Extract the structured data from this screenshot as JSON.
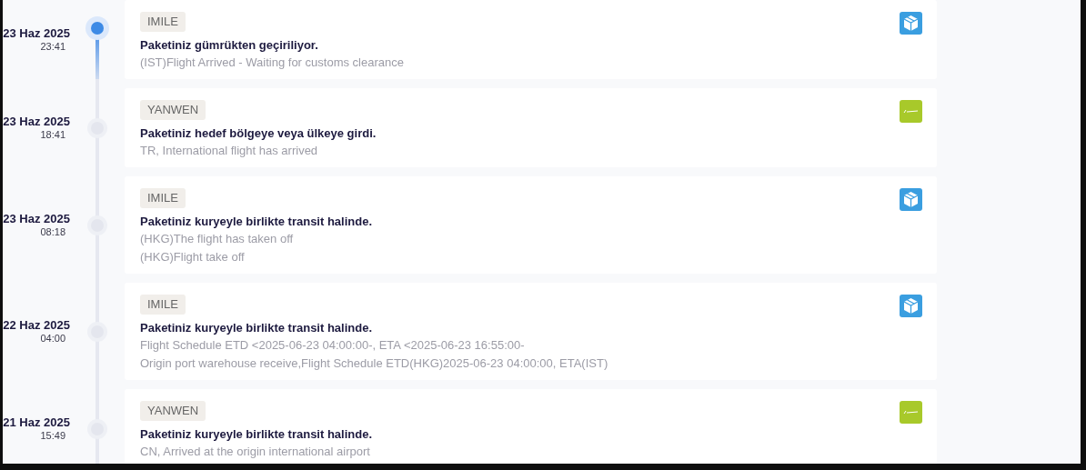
{
  "events": [
    {
      "date": "23 Haz 2025",
      "time": "23:41",
      "active": true,
      "carrier": "IMILE",
      "kind": "box",
      "title": "Paketiniz gümrükten geçiriliyor.",
      "details": [
        "(IST)Flight Arrived - Waiting for customs clearance"
      ]
    },
    {
      "date": "23 Haz 2025",
      "time": "18:41",
      "active": false,
      "carrier": "YANWEN",
      "kind": "yanwen",
      "title": "Paketiniz hedef bölgeye veya ülkeye girdi.",
      "details": [
        "TR, International flight has arrived"
      ]
    },
    {
      "date": "23 Haz 2025",
      "time": "08:18",
      "active": false,
      "carrier": "IMILE",
      "kind": "box",
      "title": "Paketiniz kuryeyle birlikte transit halinde.",
      "details": [
        "(HKG)The flight has taken off",
        "(HKG)Flight take off"
      ]
    },
    {
      "date": "22 Haz 2025",
      "time": "04:00",
      "active": false,
      "carrier": "IMILE",
      "kind": "box",
      "title": "Paketiniz kuryeyle birlikte transit halinde.",
      "details": [
        "Flight Schedule ETD <2025-06-23 04:00:00-, ETA <2025-06-23 16:55:00-",
        "Origin port warehouse receive,Flight Schedule ETD(HKG)2025-06-23 04:00:00, ETA(IST)"
      ]
    },
    {
      "date": "21 Haz 2025",
      "time": "15:49",
      "active": false,
      "carrier": "YANWEN",
      "kind": "yanwen",
      "title": "Paketiniz kuryeyle birlikte transit halinde.",
      "details": [
        "CN, Arrived at the origin international airport"
      ]
    }
  ]
}
